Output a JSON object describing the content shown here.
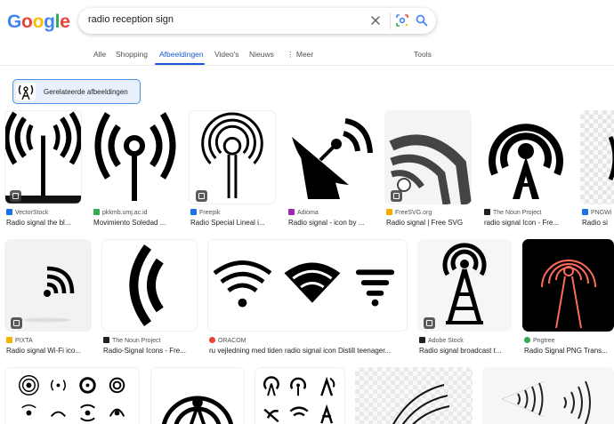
{
  "logo": {
    "letters": [
      "G",
      "o",
      "o",
      "g",
      "l",
      "e"
    ],
    "colors": [
      "#4285f4",
      "#ea4335",
      "#fbbc05",
      "#4285f4",
      "#34a853",
      "#ea4335"
    ]
  },
  "search": {
    "query": "radio reception sign"
  },
  "tabs": [
    {
      "label": "Alle"
    },
    {
      "label": "Shopping"
    },
    {
      "label": "Afbeeldingen"
    },
    {
      "label": "Video's"
    },
    {
      "label": "Nieuws"
    },
    {
      "label": "⋮ Meer"
    },
    {
      "label": "Tools"
    }
  ],
  "related": {
    "label": "Gerelateerde afbeeldingen"
  },
  "results": [
    {
      "source": "VectorStock",
      "title": "Radio signal the bl...",
      "fav": "#1a73e8"
    },
    {
      "source": "pkkmb.umj.ac.id",
      "title": "Movimiento Soledad ...",
      "fav": "#34a853"
    },
    {
      "source": "Freepik",
      "title": "Radio Special Lineal i...",
      "fav": "#1a73e8"
    },
    {
      "source": "Adioma",
      "title": "Radio signal - icon by ...",
      "fav": "#9c27b0"
    },
    {
      "source": "FreeSVG.org",
      "title": "Radio signal | Free SVG",
      "fav": "#f9ab00"
    },
    {
      "source": "The Noun Project",
      "title": "radio signal Icon - Fre...",
      "fav": "#202124"
    },
    {
      "source": "PNGWi",
      "title": "Radio si",
      "fav": "#1a73e8"
    },
    {
      "source": "PIXTA",
      "title": "Radio signal Wi-Fi ico...",
      "fav": "#f4b400"
    },
    {
      "source": "The Noun Project",
      "title": "Radio-Signal Icons - Fre...",
      "fav": "#202124"
    },
    {
      "source": "ORACOM",
      "title": "ru vejledning med tiden radio signal icon Distill teenager...",
      "fav": "#ea4335"
    },
    {
      "source": "Adobe Stock",
      "title": "Radio signal broadcast t...",
      "fav": "#202124"
    },
    {
      "source": "Pngtree",
      "title": "Radio Signal PNG Trans...",
      "fav": "#34a853"
    }
  ]
}
